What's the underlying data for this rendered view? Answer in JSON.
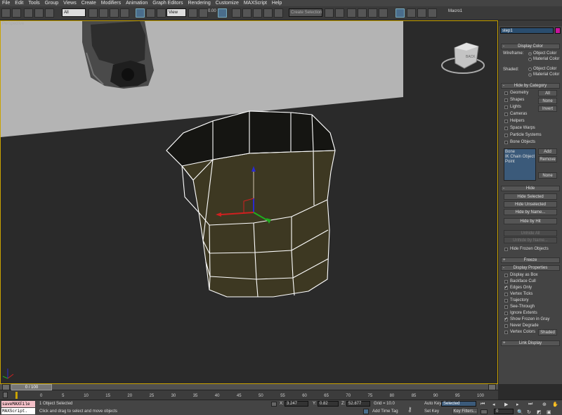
{
  "menu": [
    "File",
    "Edit",
    "Tools",
    "Group",
    "Views",
    "Create",
    "Modifiers",
    "Animation",
    "Graph Editors",
    "Rendering",
    "Customize",
    "MAXScript",
    "Help"
  ],
  "toolbar": {
    "filter": "All",
    "ref_coord": "View",
    "angle_value": "0.00",
    "selection_set": "Create Selection Se",
    "macro": "Macro1"
  },
  "viewport": {
    "label": "Perspective",
    "viewcube_face": "BACK"
  },
  "panel": {
    "object_name": "step1",
    "display_color": {
      "title": "Display Color",
      "wireframe_label": "Wireframe:",
      "shaded_label": "Shaded:",
      "object_color": "Object Color",
      "material_color": "Material Color"
    },
    "hide_by_category": {
      "title": "Hide by Category",
      "items": [
        "Geometry",
        "Shapes",
        "Lights",
        "Cameras",
        "Helpers",
        "Space Warps",
        "Particle Systems",
        "Bone Objects"
      ],
      "btn_all": "All",
      "btn_none": "None",
      "btn_invert": "Invert",
      "list": [
        "Bone",
        "IK Chain Object",
        "Point"
      ],
      "btn_add": "Add",
      "btn_remove": "Remove",
      "btn_none2": "None"
    },
    "hide": {
      "title": "Hide",
      "buttons": [
        "Hide Selected",
        "Hide Unselected",
        "Hide by Name...",
        "Hide by Hit"
      ],
      "disabled": [
        "Unhide All",
        "Unhide by Name..."
      ],
      "frozen": "Hide Frozen Objects"
    },
    "freeze": {
      "title": "Freeze"
    },
    "display_properties": {
      "title": "Display Properties",
      "items": [
        "Display as Box",
        "Backface Cull",
        "Edges Only",
        "Vertex Ticks",
        "Trajectory",
        "See-Through",
        "Ignore Extents",
        "Show Frozen in Gray",
        "Never Degrade",
        "Vertex Colors"
      ],
      "checked": [
        false,
        false,
        true,
        false,
        false,
        false,
        false,
        true,
        false,
        false
      ],
      "shaded_btn": "Shaded"
    },
    "link_display": {
      "title": "Link Display"
    }
  },
  "timeline": {
    "frame_counter": "0 / 100",
    "ticks": [
      "0",
      "5",
      "10",
      "15",
      "20",
      "25",
      "30",
      "35",
      "40",
      "45",
      "50",
      "55",
      "60",
      "65",
      "70",
      "75",
      "80",
      "85",
      "90",
      "95",
      "100"
    ]
  },
  "status": {
    "script_line1": "saveMAXFile",
    "script_line2": "MAXScript.",
    "selected": "1 Object Selected",
    "prompt": "Click and drag to select and move objects",
    "x_label": "X:",
    "x_value": "3.247",
    "y_label": "Y:",
    "y_value": "0.82",
    "z_label": "Z:",
    "z_value": "52.877",
    "grid": "Grid = 10.0",
    "add_time_tag": "Add Time Tag",
    "auto_key": "Auto Key",
    "set_key": "Set Key",
    "key_mode": "Selected",
    "key_filters": "Key Filters...",
    "frame": "0"
  },
  "colors": {
    "accent": "#c9a300",
    "selection_blue": "#4a6d8c",
    "highlight_panel": "#3b5a7a",
    "magenta_swatch": "#c8149c",
    "mesh_fill": "#3d3822"
  }
}
